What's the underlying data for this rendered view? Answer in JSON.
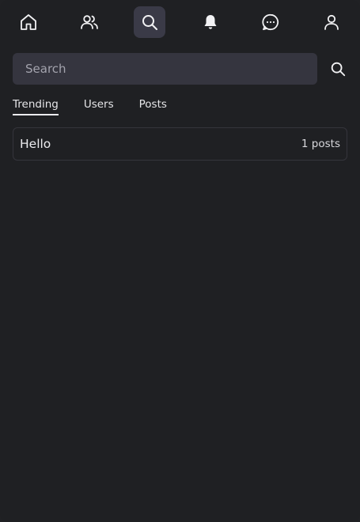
{
  "nav": {
    "items": [
      {
        "name": "home",
        "icon": "home-icon",
        "active": false
      },
      {
        "name": "users",
        "icon": "users-icon",
        "active": false
      },
      {
        "name": "search",
        "icon": "search-icon",
        "active": true
      },
      {
        "name": "notifications",
        "icon": "bell-icon",
        "active": false
      },
      {
        "name": "messages",
        "icon": "chat-bubble-icon",
        "active": false
      },
      {
        "name": "profile",
        "icon": "user-icon",
        "active": false
      }
    ]
  },
  "search": {
    "placeholder": "Search",
    "value": "",
    "submit_icon": "search-icon"
  },
  "tabs": [
    {
      "label": "Trending",
      "active": true
    },
    {
      "label": "Users",
      "active": false
    },
    {
      "label": "Posts",
      "active": false
    }
  ],
  "results": [
    {
      "title": "Hello",
      "count": "1 posts"
    }
  ],
  "colors": {
    "background": "#1f2023",
    "active_nav_bg": "#3a3a47",
    "input_bg": "#35353f",
    "border": "#35353c",
    "text": "#ececef"
  }
}
